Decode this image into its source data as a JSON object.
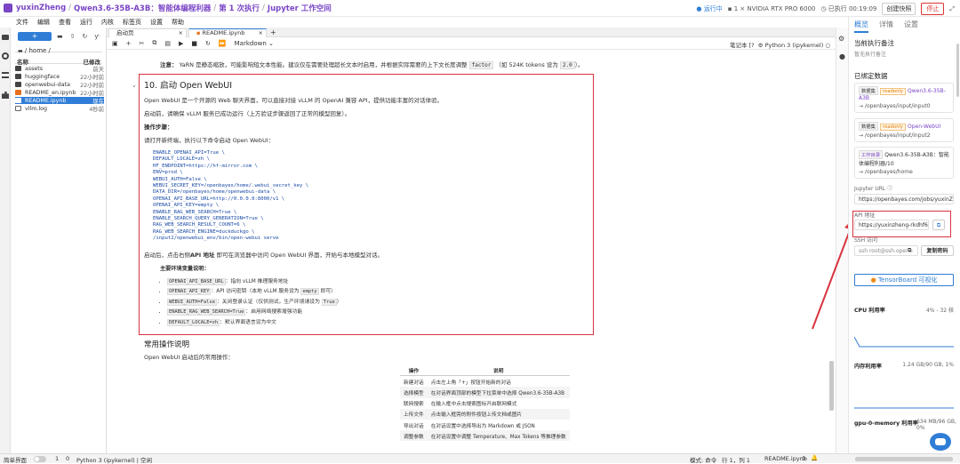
{
  "topbar": {
    "user": "yuxinZheng",
    "project": "Qwen3.6-35B-A3B：智能体编程利器",
    "run": "第 1 次执行",
    "workspace": "Jupyter 工作空间",
    "status": "运行中",
    "gpu": "1 × NVIDIA RTX PRO 6000",
    "elapsed": "已执行 00:19:09",
    "snapshot_btn": "创建快照",
    "stop_btn": "停止"
  },
  "menu": [
    "文件",
    "编辑",
    "查看",
    "运行",
    "内核",
    "标签页",
    "设置",
    "帮助"
  ],
  "filepanel": {
    "new_btn": "+",
    "path": "/ home /",
    "col_name": "名称",
    "col_time": "已修改",
    "files": [
      {
        "name": "assets",
        "time": "前天",
        "kind": "folder"
      },
      {
        "name": "huggingface",
        "time": "22小时前",
        "kind": "folder"
      },
      {
        "name": "openwebui-data",
        "time": "22小时前",
        "kind": "folder"
      },
      {
        "name": "README_en.ipynb",
        "time": "22小时前",
        "kind": "notebook"
      },
      {
        "name": "README.ipynb",
        "time": "现在",
        "kind": "notebook"
      },
      {
        "name": "vllm.log",
        "time": "4秒前",
        "kind": "file"
      }
    ]
  },
  "tabs": [
    {
      "label": "启动页"
    },
    {
      "label": "README.ipynb"
    }
  ],
  "nbtoolbar": {
    "celltype": "Markdown",
    "kernel": "Python 3 (ipykernel)",
    "label": "笔记本 [?"
  },
  "notebook": {
    "note_prefix": "注意：",
    "note_text": "YaRN 是静态缩放，可能影响短文本性能。建议仅在需要处理超长文本时启用，并根据实际需要的上下文长度调整",
    "note_code1": "factor",
    "note_mid": "（如 524K tokens 设为",
    "note_code2": "2.0",
    "note_end": "）。",
    "heading": "10. 启动 Open WebUI",
    "intro": "Open WebUI 是一个开源的 Web 聊天界面，可以直接对接 vLLM 的 OpenAI 兼容 API，提供功能丰富的对话体验。",
    "pre_start": "启动前，请确保 vLLM 服务已成功运行（上方验证步骤返回了正常的模型回复）。",
    "steps_title": "操作步骤：",
    "steps_text": "请打开新终端，执行以下命令启动 Open WebUI：",
    "code_lines": [
      "ENABLE_OPENAI_API=True \\",
      "DEFAULT_LOCALE=zh \\",
      "HF_ENDPOINT=https://hf-mirror.com \\",
      "ENV=prod \\",
      "WEBUI_AUTH=False \\",
      "WEBUI_SECRET_KEY=/openbayes/home/.webui_secret_key \\",
      "DATA_DIR=/openbayes/home/openwebui-data \\",
      "OPENAI_API_BASE_URL=http://0.0.0.0:8000/v1 \\",
      "OPENAI_API_KEY=empty \\",
      "ENABLE_RAG_WEB_SEARCH=True \\",
      "ENABLE_SEARCH_QUERY_GENERATION=True \\",
      "RAG_WEB_SEARCH_RESULT_COUNT=6 \\",
      "RAG_WEB_SEARCH_ENGINE=duckduckgo \\",
      "/input2/openwebui_env/bin/open-webui serve"
    ],
    "after_start_pre": "启动后，点击右侧",
    "after_start_bold": "API 地址",
    "after_start_post": "即可在浏览器中访问 Open WebUI 界面，开始与本地模型对话。",
    "env_title": "主要环境变量说明：",
    "env_items": [
      {
        "code": "OPENAI_API_BASE_URL",
        "desc": "：指向 vLLM 推理服务地址"
      },
      {
        "code": "OPENAI_API_KEY",
        "desc": "：API 访问密钥（本地 vLLM 服务设为",
        "code2": "empty",
        "desc2": "即可）"
      },
      {
        "code": "WEBUI_AUTH=False",
        "desc": "：关闭登录认证（仅供测试，生产环境请设为",
        "code2": "True",
        "desc2": "）"
      },
      {
        "code": "ENABLE_RAG_WEB_SEARCH=True",
        "desc": "：启用网络搜索增强功能"
      },
      {
        "code": "DEFAULT_LOCALE=zh",
        "desc": "：默认界面语言设为中文"
      }
    ],
    "ops_heading": "常用操作说明",
    "ops_intro": "Open WebUI 启动后的常用操作：",
    "ops_cols": [
      "操作",
      "说明"
    ],
    "ops_rows": [
      [
        "新建对话",
        "点击左上角「+」按钮开始新的对话"
      ],
      [
        "选择模型",
        "在对话界面顶部的模型下拉菜单中选择 Qwen3.6-35B-A3B"
      ],
      [
        "联网搜索",
        "在输入框中点击搜索图标开启联网模式"
      ],
      [
        "上传文件",
        "点击输入框旁的附件按钮上传文档或图片"
      ],
      [
        "导出对话",
        "在对话设置中选择导出为 Markdown 或 JSON"
      ],
      [
        "调整参数",
        "在对话设置中调整 Temperature、Max Tokens 等推理参数"
      ]
    ]
  },
  "rpanel": {
    "tabs": [
      "概览",
      "详情",
      "设置"
    ],
    "note_title": "当前执行备注",
    "note_empty": "暂无执行备注",
    "mounted_title": "已绑定数据",
    "datasets": [
      {
        "tag": "数据集",
        "ro": "readonly",
        "name": "Qwen3.6-35B-A3B",
        "path": "→ /openbayes/input/input0"
      },
      {
        "tag": "数据集",
        "ro": "readonly",
        "name": "Open-WebUI",
        "path": "→ /openbayes/input/input2"
      },
      {
        "tag": "工作目录",
        "ro": "",
        "name": "Qwen3.6-35B-A3B：智能体编程利器/10",
        "path": "→ /openbayes/home"
      }
    ],
    "jupyter_label": "Jupyter URL",
    "jupyter_url": "https://openbayes.com/jobs/yuxinZ",
    "api_label": "API 地址",
    "api_url": "https://yuxinzheng-rkdhf6r",
    "ssh_label": "SSH 访问",
    "ssh_value": "ssh root@ssh.openb",
    "ssh_btn": "复制密码",
    "tensorboard_btn": "TensorBoard 可视化",
    "metrics": [
      {
        "label": "CPU 利用率",
        "value": "4% - 32 核"
      },
      {
        "label": "内存利用率",
        "value": "1.24 GB/90 GB, 1%"
      },
      {
        "label": "gpu-0-memory 利用率",
        "value": "634 MB/96 GB, 0%"
      }
    ]
  },
  "statusbar": {
    "simple": "简单界面",
    "count1": "1",
    "count2": "0",
    "kernel": "Python 3 (ipykernel) | 空闲",
    "mode": "模式: 命令",
    "pos": "行 1，列 1",
    "file": "README.ipynb",
    "count3": "0"
  }
}
